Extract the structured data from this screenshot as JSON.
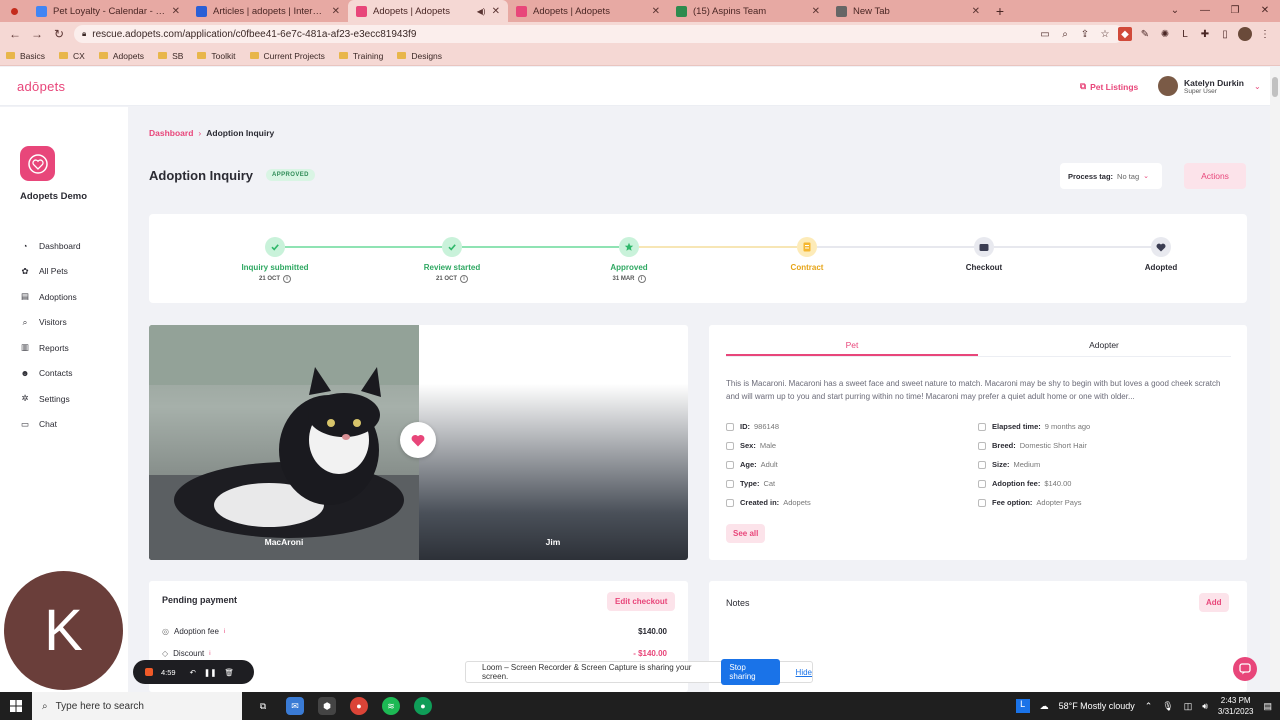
{
  "browser": {
    "tabs": [
      {
        "label": "Pet Loyalty - Calendar - Week of",
        "favicon_color": "#4285f4",
        "active": false
      },
      {
        "label": "Articles | adopets | Intercom",
        "favicon_color": "#2a5fd6",
        "active": false
      },
      {
        "label": "Adopets | Adopets",
        "favicon_color": "#e8467a",
        "active": true
      },
      {
        "label": "Adopets | Adopets",
        "favicon_color": "#e8467a",
        "active": false
      },
      {
        "label": "(15) Aspins Team",
        "favicon_color": "#2d8b4e",
        "active": false
      },
      {
        "label": "New Tab",
        "favicon_color": "#666666",
        "active": false
      }
    ],
    "url": "rescue.adopets.com/application/c0fbee41-6e7c-481a-af23-e3ecc81943f9",
    "bookmarks": [
      "Basics",
      "CX",
      "Adopets",
      "SB",
      "Toolkit",
      "Current Projects",
      "Training",
      "Designs"
    ]
  },
  "header": {
    "logo": "adōpets",
    "pet_listings": "Pet Listings",
    "user_name": "Katelyn Durkin",
    "user_role": "Super User"
  },
  "sidebar": {
    "org_name": "Adopets Demo",
    "items": [
      {
        "label": "Dashboard",
        "icon": "pie-chart-icon"
      },
      {
        "label": "All Pets",
        "icon": "paw-icon"
      },
      {
        "label": "Adoptions",
        "icon": "clipboard-icon"
      },
      {
        "label": "Visitors",
        "icon": "search-icon"
      },
      {
        "label": "Reports",
        "icon": "report-icon"
      },
      {
        "label": "Contacts",
        "icon": "contact-icon"
      },
      {
        "label": "Settings",
        "icon": "gear-icon"
      },
      {
        "label": "Chat",
        "icon": "chat-icon"
      }
    ]
  },
  "page": {
    "breadcrumb": {
      "parent": "Dashboard",
      "current": "Adoption Inquiry"
    },
    "title": "Adoption Inquiry",
    "status": "APPROVED",
    "process_tag_label": "Process tag:",
    "process_tag_value": "No tag",
    "actions_label": "Actions"
  },
  "steps": [
    {
      "label": "Inquiry submitted",
      "date": "21 OCT",
      "state": "done"
    },
    {
      "label": "Review started",
      "date": "21 OCT",
      "state": "done"
    },
    {
      "label": "Approved",
      "date": "31 MAR",
      "state": "done"
    },
    {
      "label": "Contract",
      "date": "",
      "state": "current"
    },
    {
      "label": "Checkout",
      "date": "",
      "state": "pending"
    },
    {
      "label": "Adopted",
      "date": "",
      "state": "pending"
    }
  ],
  "pet_card": {
    "pet_name": "MacAroni",
    "adopter_name": "Jim"
  },
  "details": {
    "tabs": [
      "Pet",
      "Adopter"
    ],
    "description": "This is Macaroni. Macaroni has a sweet face and sweet nature to match. Macaroni may be shy to begin with but loves a good cheek scratch and will warm up to you and start purring within no time! Macaroni may prefer a quiet adult home or one with older...",
    "left": [
      {
        "key": "ID:",
        "value": "986148"
      },
      {
        "key": "Sex:",
        "value": "Male"
      },
      {
        "key": "Age:",
        "value": "Adult"
      },
      {
        "key": "Type:",
        "value": "Cat"
      },
      {
        "key": "Created in:",
        "value": "Adopets"
      }
    ],
    "right": [
      {
        "key": "Elapsed time:",
        "value": "9 months ago"
      },
      {
        "key": "Breed:",
        "value": "Domestic Short Hair"
      },
      {
        "key": "Size:",
        "value": "Medium"
      },
      {
        "key": "Adoption fee:",
        "value": "$140.00"
      },
      {
        "key": "Fee option:",
        "value": "Adopter Pays"
      }
    ],
    "see_all": "See all"
  },
  "payment": {
    "title": "Pending payment",
    "edit_label": "Edit checkout",
    "rows": [
      {
        "label": "Adoption fee",
        "value": "$140.00",
        "value_color": "#2b2b33"
      },
      {
        "label": "Discount",
        "value": "- $140.00",
        "value_color": "#e8467a"
      }
    ]
  },
  "notes": {
    "title": "Notes",
    "add_label": "Add"
  },
  "overlays": {
    "avatar_letter": "K",
    "rec_time": "4:59",
    "share_text": "Loom – Screen Recorder & Screen Capture is sharing your screen.",
    "stop_sharing": "Stop sharing",
    "hide": "Hide"
  },
  "taskbar": {
    "search_placeholder": "Type here to search",
    "weather": "58°F  Mostly cloudy",
    "time": "2:43 PM",
    "date": "3/31/2023"
  },
  "colors": {
    "accent": "#e8467a",
    "success": "#3ccf7a",
    "warning": "#f5b731",
    "pending": "#3b3d52"
  }
}
